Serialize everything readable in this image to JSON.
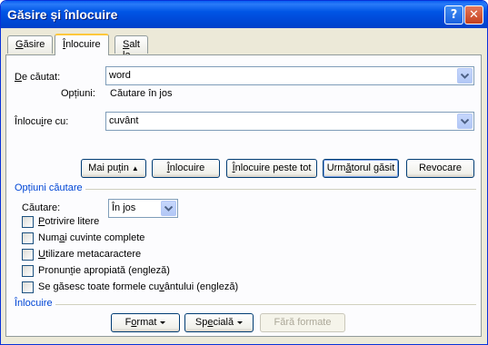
{
  "window": {
    "title": "Găsire și înlocuire"
  },
  "tabs": [
    {
      "label": "Găsire",
      "accel": "G",
      "rest": "ăsire"
    },
    {
      "label": "Înlocuire",
      "accel": "Î",
      "rest": "nlocuire"
    },
    {
      "label": "Salt la",
      "accel": "S",
      "rest": "alt la"
    }
  ],
  "find": {
    "label": "De căutat:",
    "label_pre": "",
    "label_accel": "D",
    "label_post": "e căutat:",
    "value": "word",
    "options_label": "Opțiuni:",
    "options_value": "Căutare în jos"
  },
  "replace": {
    "label": "Înlocuire cu:",
    "label_pre": "Înlocu",
    "label_accel": "i",
    "label_post": "re cu:",
    "value": "cuvânt"
  },
  "buttons": {
    "less": {
      "label": "Mai puțin",
      "pre": "Mai pu",
      "accel": "ț",
      "post": "in ⯭",
      "arrow": "⯭"
    },
    "replace": {
      "label": "Înlocuire",
      "pre": "",
      "accel": "Î",
      "post": "nlocuire"
    },
    "replace_all": {
      "label": "Înlocuire peste tot",
      "pre": "",
      "accel": "Î",
      "post": "nlocuire peste tot"
    },
    "find_next": {
      "label": "Următorul găsit",
      "pre": "Urm",
      "accel": "ă",
      "post": "torul găsit"
    },
    "cancel": {
      "label": "Revocare"
    }
  },
  "search_options": {
    "title": "Opțiuni căutare",
    "search_label": "Căutare:",
    "search_value": "În jos",
    "checkboxes": [
      {
        "label": "Potrivire litere",
        "pre": "",
        "accel": "P",
        "post": "otrivire litere",
        "checked": false
      },
      {
        "label": "Numai cuvinte complete",
        "pre": "Num",
        "accel": "a",
        "post": "i cuvinte complete",
        "checked": false
      },
      {
        "label": "Utilizare metacaractere",
        "pre": "",
        "accel": "U",
        "post": "tilizare metacaractere",
        "checked": false
      },
      {
        "label": "Pronunție apropiată (engleză)",
        "pre": "Pronun",
        "accel": "ț",
        "post": "ie apropiată (engleză)",
        "checked": false
      },
      {
        "label": "Se găsesc toate formele cuvântului (engleză)",
        "pre": "Se găsesc toate formele cu",
        "accel": "v",
        "post": "ântului (engleză)",
        "checked": false
      }
    ]
  },
  "replace_section": {
    "title": "Înlocuire",
    "format": {
      "label": "Format",
      "pre": "F",
      "accel": "o",
      "post": "rmat"
    },
    "special": {
      "label": "Specială",
      "pre": "Sp",
      "accel": "e",
      "post": "cială"
    },
    "no_format": {
      "label": "Fără formate"
    }
  }
}
